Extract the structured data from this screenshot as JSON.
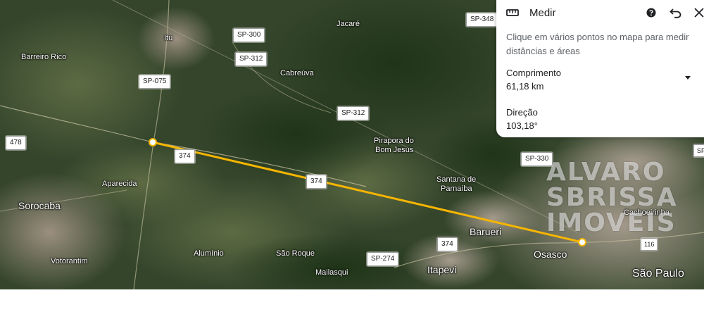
{
  "panel": {
    "title": "Medir",
    "description": "Clique em vários pontos no mapa para medir distâncias e áreas",
    "length_label": "Comprimento",
    "length_value": "61,18 km",
    "direction_label": "Direção",
    "direction_value": "103,18°",
    "icons": [
      "ruler-icon",
      "help-icon",
      "undo-icon",
      "close-icon"
    ]
  },
  "map": {
    "places": {
      "itu": "Itu",
      "jacare": "Jacaré",
      "barreiro_rico": "Barreiro Rico",
      "cabreuva": "Cabreúva",
      "pirapora_1": "Pirapora do",
      "pirapora_2": "Bom Jesus",
      "aparecida": "Aparecida",
      "sorocaba": "Sorocaba",
      "santana_1": "Santana de",
      "santana_2": "Parnaíba",
      "barueri": "Barueri",
      "votorantim": "Votorantim",
      "aluminio": "Alumínio",
      "sao_roque": "São Roque",
      "mailasqui": "Mailasqui",
      "itapevi": "Itapevi",
      "osasco": "Osasco",
      "cachoeirinha": "Cachoeirinha",
      "sao_paulo": "São Paulo"
    },
    "shields": {
      "sp300": "SP-300",
      "sp312_a": "SP-312",
      "sp312_b": "SP-312",
      "sp075": "SP-075",
      "sp348": "SP-348",
      "r478": "478",
      "r374_a": "374",
      "r374_b": "374",
      "r374_c": "374",
      "sp330": "SP-330",
      "sp274": "SP-274",
      "r116": "116",
      "edge": "SF"
    },
    "route_color": "#f6b500",
    "watermark": [
      "ALVARO",
      "SBRISSA",
      "IMOVEIS"
    ]
  }
}
